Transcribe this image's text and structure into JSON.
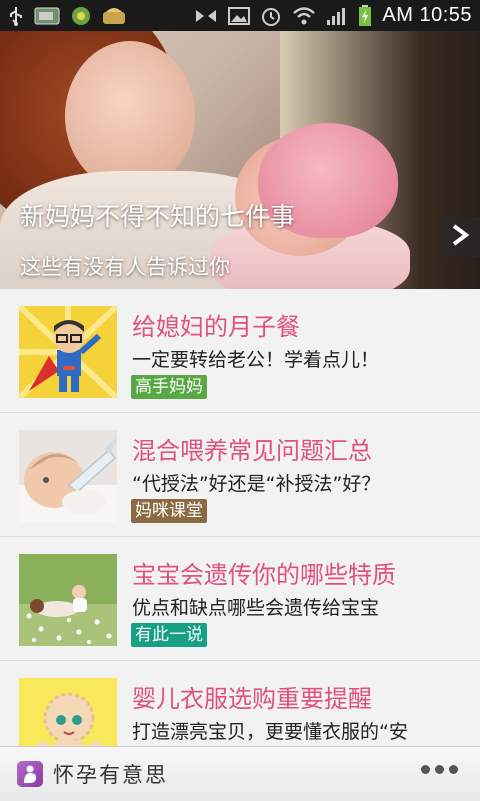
{
  "status_bar": {
    "time": "AM 10:55",
    "icons_left": [
      "usb-icon",
      "sd-card-icon",
      "app-notify-icon",
      "app-notify-icon-2"
    ],
    "icons_right": [
      "flip-icon",
      "image-icon",
      "alarm-icon",
      "wifi-icon",
      "signal-icon",
      "battery-charging-icon"
    ]
  },
  "banner": {
    "title": "新妈妈不得不知的七件事",
    "subtitle": "这些有没有人告诉过你",
    "next_icon": "chevron-right-icon"
  },
  "articles": [
    {
      "title": "给媳妇的月子餐",
      "desc": "一定要转给老公！学着点儿！",
      "tag": "高手妈妈",
      "tag_color": "#5aa843"
    },
    {
      "title": "混合喂养常见问题汇总",
      "desc": "“代授法”好还是“补授法”好？",
      "tag": "妈咪课堂",
      "tag_color": "#8a6a43"
    },
    {
      "title": "宝宝会遗传你的哪些特质",
      "desc": "优点和缺点哪些会遗传给宝宝",
      "tag": "有此一说",
      "tag_color": "#17a086"
    },
    {
      "title": "婴儿衣服选购重要提醒",
      "desc": "打造漂亮宝贝，更要懂衣服的“安",
      "tag": "",
      "tag_color": ""
    }
  ],
  "bottom_bar": {
    "app_name": "怀孕有意思",
    "more_icon": "more-dots-icon"
  },
  "colors": {
    "title_pink": "#e0517b",
    "background": "#f2f2f2",
    "status_bar": "#1a1a1a"
  }
}
